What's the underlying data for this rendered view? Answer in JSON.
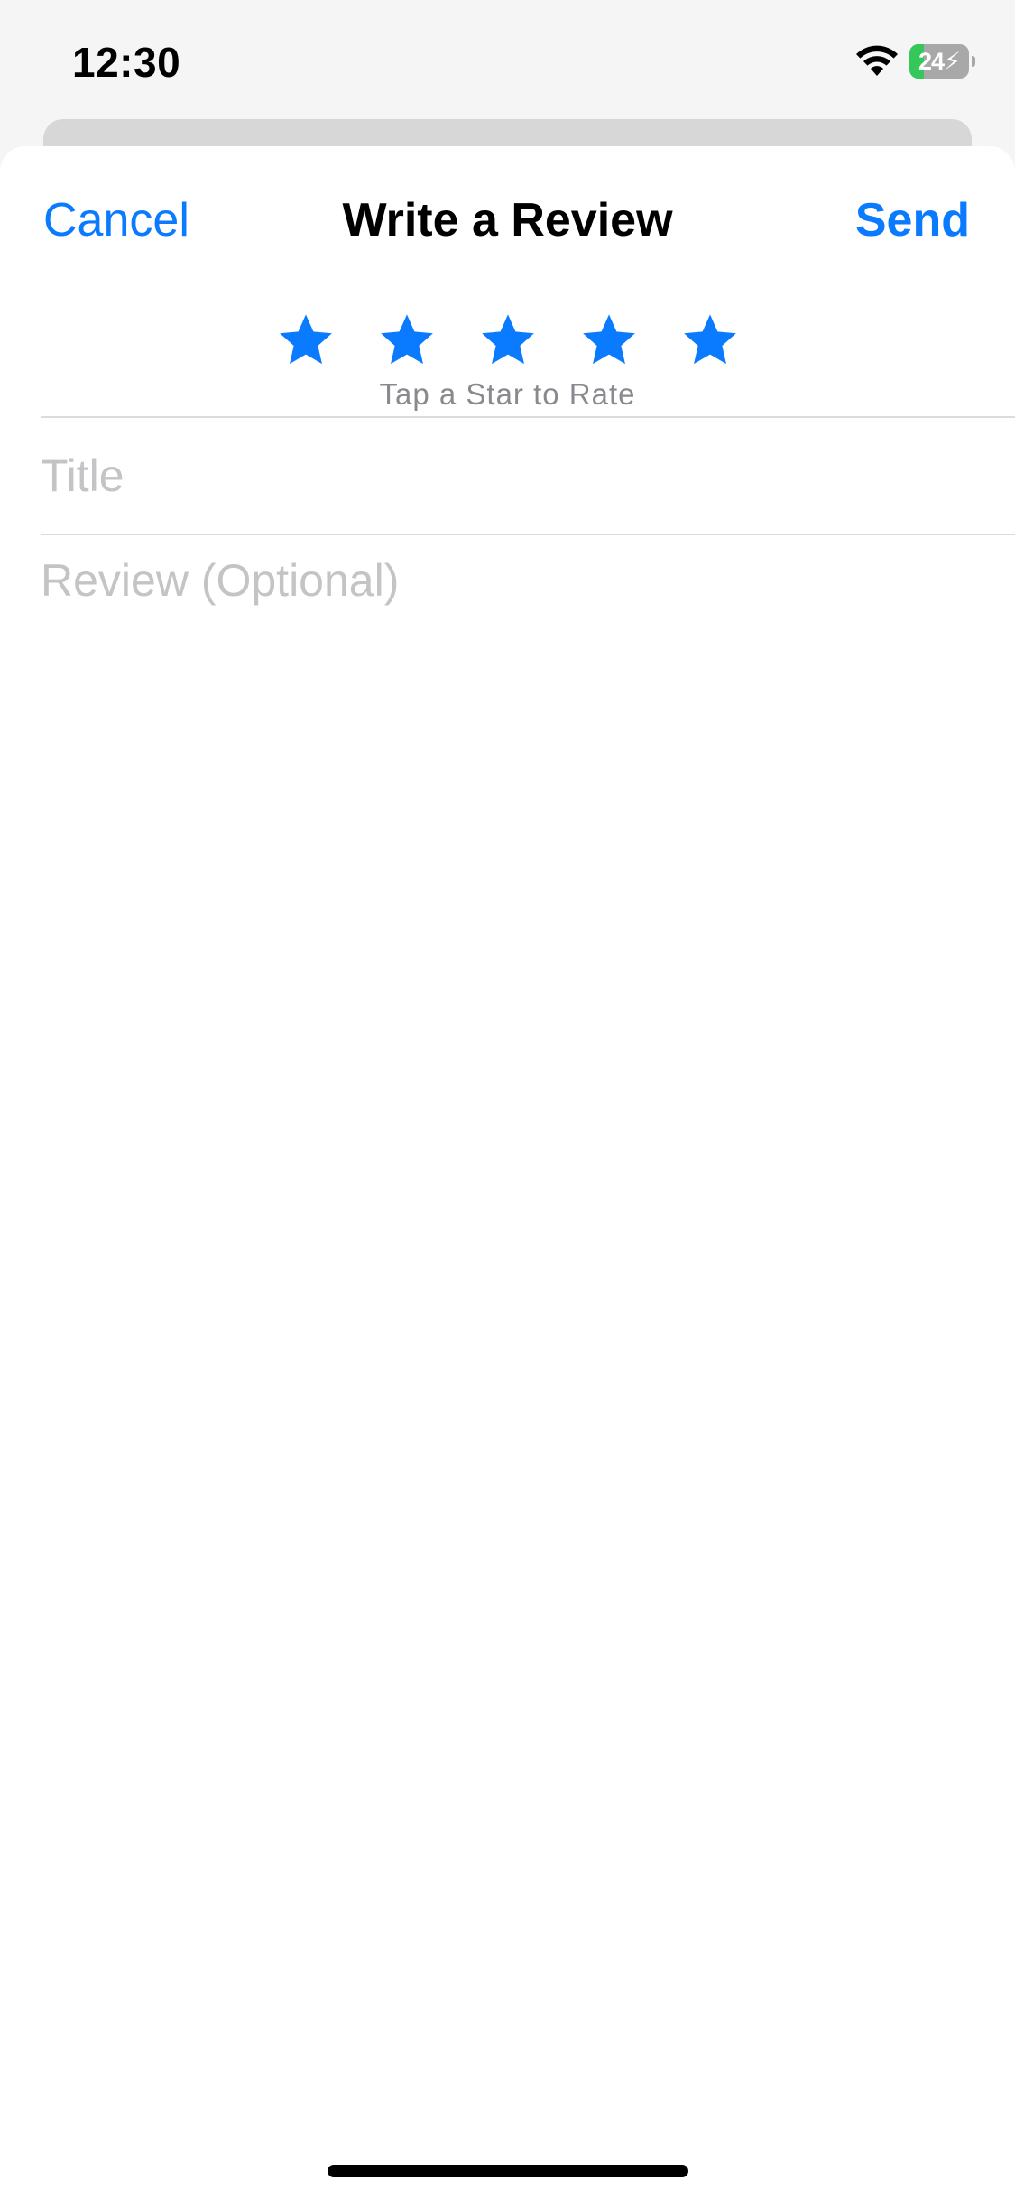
{
  "status_bar": {
    "time": "12:30",
    "battery_level": "24",
    "battery_fraction": 0.24,
    "battery_color": "#34c759",
    "icons": [
      "wifi-icon",
      "battery-charging-icon"
    ]
  },
  "nav": {
    "cancel_label": "Cancel",
    "title": "Write a Review",
    "send_label": "Send",
    "accent_color": "#0a7aff"
  },
  "rating": {
    "star_count": 5,
    "stars": [
      "1",
      "2",
      "3",
      "4",
      "5"
    ],
    "hint": "Tap a Star to Rate",
    "star_color": "#0a7aff",
    "icon": "star-icon"
  },
  "form": {
    "title_placeholder": "Title",
    "title_value": "",
    "review_placeholder": "Review (Optional)",
    "review_value": ""
  }
}
